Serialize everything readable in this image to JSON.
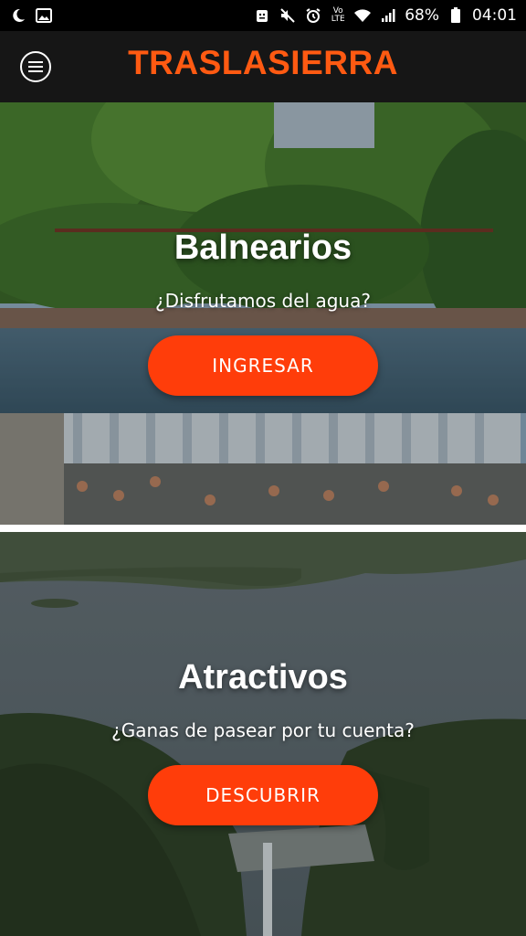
{
  "status_bar": {
    "battery_percent": "68%",
    "time": "04:01",
    "network_label": "Vo LTE",
    "icons": [
      "moon-icon",
      "image-icon",
      "android-icon",
      "mute-icon",
      "alarm-icon",
      "volte-icon",
      "wifi-icon",
      "signal-icon",
      "battery-icon"
    ]
  },
  "header": {
    "title": "TRASLASIERRA",
    "menu_icon": "menu-circle-icon",
    "title_color": "#ff5a12"
  },
  "cards": [
    {
      "title": "Balnearios",
      "subtitle": "¿Disfrutamos del agua?",
      "button_label": "INGRESAR"
    },
    {
      "title": "Atractivos",
      "subtitle": "¿Ganas de pasear por tu cuenta?",
      "button_label": "DESCUBRIR"
    }
  ],
  "colors": {
    "accent": "#ff3d0a",
    "header_bg": "#161616"
  }
}
